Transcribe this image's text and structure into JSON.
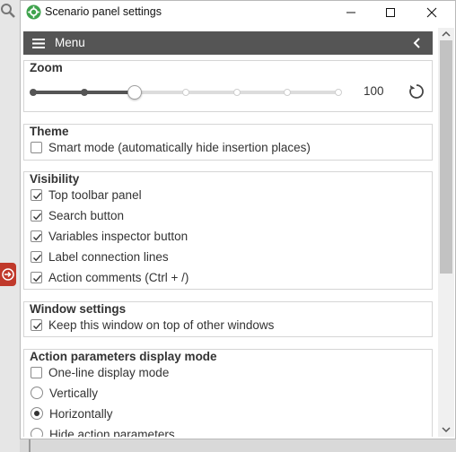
{
  "window": {
    "title": "Scenario panel settings"
  },
  "menu": {
    "label": "Menu"
  },
  "zoom": {
    "title": "Zoom",
    "value": "100",
    "level_index": 2,
    "steps": 7
  },
  "theme": {
    "title": "Theme",
    "items": [
      {
        "label": "Smart mode (automatically hide insertion places)",
        "checked": false
      }
    ]
  },
  "visibility": {
    "title": "Visibility",
    "items": [
      {
        "label": "Top toolbar panel",
        "checked": true
      },
      {
        "label": "Search button",
        "checked": true
      },
      {
        "label": "Variables inspector button",
        "checked": true
      },
      {
        "label": "Label connection lines",
        "checked": true
      },
      {
        "label": "Action comments (Ctrl + /)",
        "checked": true
      }
    ]
  },
  "window_settings": {
    "title": "Window settings",
    "items": [
      {
        "label": "Keep this window on top of other windows",
        "checked": true
      }
    ]
  },
  "action_params": {
    "title": "Action parameters display mode",
    "checkbox": {
      "label": "One-line display mode",
      "checked": false
    },
    "options": [
      {
        "label": "Vertically",
        "selected": false
      },
      {
        "label": "Horizontally",
        "selected": true
      },
      {
        "label": "Hide action parameters",
        "selected": false
      }
    ]
  },
  "colors": {
    "menu_bg": "#555555",
    "accent_green": "#3fa34d",
    "exit_red": "#c0392b"
  }
}
